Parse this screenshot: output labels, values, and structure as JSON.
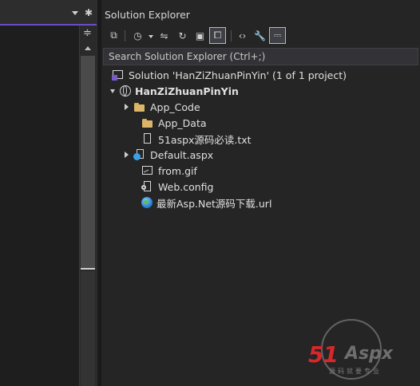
{
  "left_pane": {
    "split_glyph": "≑",
    "gear_glyph": "✱"
  },
  "solution_explorer": {
    "title": "Solution Explorer",
    "search": {
      "placeholder": "Search Solution Explorer (Ctrl+;)",
      "value": ""
    },
    "toolbar": [
      {
        "name": "switch-views",
        "glyph": "⧉"
      },
      {
        "name": "pending-changes",
        "glyph": "◷"
      },
      {
        "name": "sync-active",
        "glyph": "⇋"
      },
      {
        "name": "refresh",
        "glyph": "↻"
      },
      {
        "name": "collapse-all",
        "glyph": "▣"
      },
      {
        "name": "show-all-files",
        "glyph": "⧠"
      },
      {
        "name": "view-code",
        "glyph": "‹›"
      },
      {
        "name": "properties",
        "glyph": "🔧"
      },
      {
        "name": "preview-selected",
        "glyph": "⎓"
      }
    ],
    "tree": {
      "solution_label": "Solution 'HanZiZhuanPinYin' (1 of 1 project)",
      "project_label": "HanZiZhuanPinYin",
      "items": [
        {
          "label": "App_Code",
          "icon": "folder-icon",
          "expandable": true
        },
        {
          "label": "App_Data",
          "icon": "folder-icon",
          "expandable": false
        },
        {
          "label": "51aspx源码必读.txt",
          "icon": "text-file-icon",
          "expandable": false
        },
        {
          "label": "Default.aspx",
          "icon": "aspx-file-icon",
          "expandable": true
        },
        {
          "label": "from.gif",
          "icon": "image-file-icon",
          "expandable": false
        },
        {
          "label": "Web.config",
          "icon": "config-file-icon",
          "expandable": false
        },
        {
          "label": "最新Asp.Net源码下载.url",
          "icon": "url-file-icon",
          "expandable": false
        }
      ]
    }
  },
  "watermark": {
    "brand_number": "51",
    "brand_text": "Aspx",
    "subtitle": "源码就要专业"
  },
  "colors": {
    "accent": "#6a4cc7",
    "folder": "#dcb56a",
    "logo_red": "#d6272a"
  }
}
